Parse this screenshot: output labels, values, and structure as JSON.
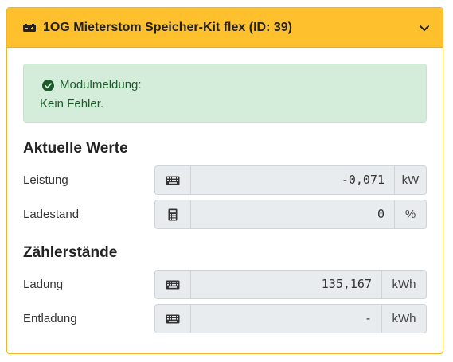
{
  "header": {
    "title": "1OG Mieterstom Speicher-Kit flex (ID: 39)",
    "icon": "battery-icon",
    "toggle_icon": "chevron-down-icon"
  },
  "alert": {
    "heading": "Modulmeldung:",
    "message": "Kein Fehler.",
    "icon": "check-circle-icon"
  },
  "current_values": {
    "title": "Aktuelle Werte",
    "rows": [
      {
        "label": "Leistung",
        "icon": "keyboard-icon",
        "value": "-0,071",
        "unit": "kW"
      },
      {
        "label": "Ladestand",
        "icon": "calculator-icon",
        "value": "0",
        "unit": "%"
      }
    ]
  },
  "meter_readings": {
    "title": "Zählerstände",
    "rows": [
      {
        "label": "Ladung",
        "icon": "keyboard-icon",
        "value": "135,167",
        "unit": "kWh"
      },
      {
        "label": "Entladung",
        "icon": "keyboard-icon",
        "value": "-",
        "unit": "kWh"
      }
    ]
  },
  "colors": {
    "header_bg": "#ffc02d",
    "alert_bg": "#d4eddb",
    "alert_text": "#1c5b2a",
    "field_bg": "#e9ecef"
  }
}
